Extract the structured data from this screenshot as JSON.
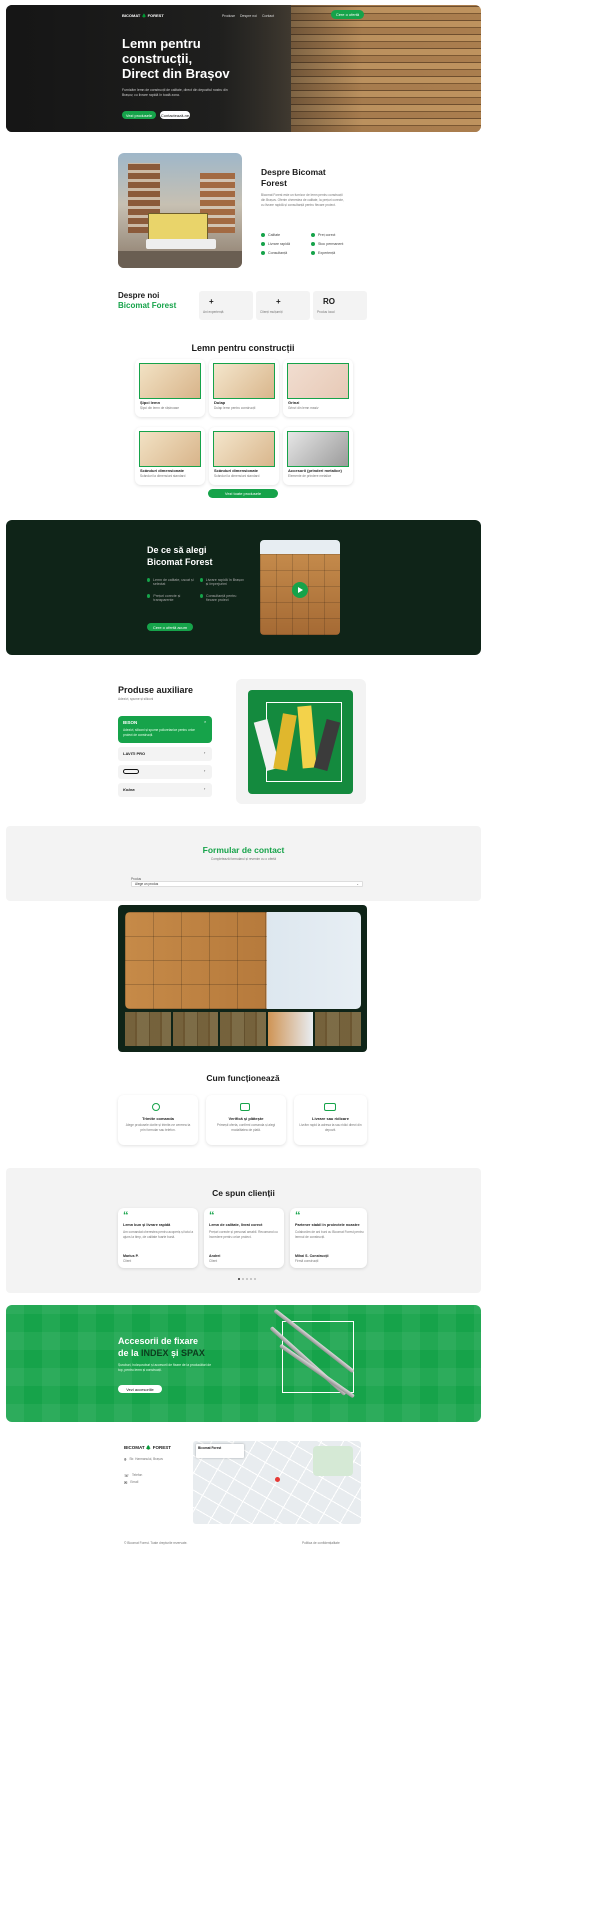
{
  "colors": {
    "accent": "#16a34a",
    "dark_green": "#0f2418",
    "grey": "#f3f3f3"
  },
  "nav": {
    "logo_text": "BICOMAT 🌲 FOREST",
    "links": [
      "Produse",
      "Despre noi",
      "Contact"
    ],
    "cta": "Cere o ofertă"
  },
  "hero": {
    "title_line1": "Lemn pentru",
    "title_line2": "construcții,",
    "title_line3": "Direct din Brașov",
    "desc": "Furnizăm lemn de construcții de calitate, direct din depozitul nostru din Brașov, cu livrare rapidă în toată zona.",
    "btn_primary": "Vezi produsele",
    "btn_secondary": "Contactează-ne"
  },
  "about": {
    "title": "Despre Bicomat Forest",
    "desc": "Bicomat Forest este un furnizor de lemn pentru construcții din Brașov. Oferim cherestea de calitate, la prețuri corecte, cu livrare rapidă și consultanță pentru fiecare proiect.",
    "features": [
      "Calitate",
      "Preț corect",
      "Livrare rapidă",
      "Stoc permanent",
      "Consultanță",
      "Experiență"
    ]
  },
  "stats": {
    "title_1": "Despre noi",
    "title_2": "Bicomat Forest",
    "items": [
      {
        "value": "+",
        "label": "Ani experiență"
      },
      {
        "value": "+",
        "label": "Clienți mulțumiți"
      },
      {
        "value": "RO",
        "label": "Produs local"
      }
    ]
  },
  "products": {
    "title": "Lemn pentru construcții",
    "items": [
      {
        "name": "Șipci lemn",
        "desc": "Șipci din lemn de rășinoase"
      },
      {
        "name": "Dulap",
        "desc": "Dulap lemn pentru construcții"
      },
      {
        "name": "Grinzi",
        "desc": "Grinzi din lemn masiv"
      },
      {
        "name": "Scânduri dimensionate",
        "desc": "Scânduri la dimensiuni standard"
      },
      {
        "name": "Scânduri dimensionate",
        "desc": "Scânduri la dimensiuni standard"
      },
      {
        "name": "Accesorii (prinderi metalice)",
        "desc": "Elemente de prindere metalice"
      }
    ],
    "cta": "Vezi toate produsele"
  },
  "why": {
    "title_line1": "De ce să alegi",
    "title_line2": "Bicomat Forest",
    "features": [
      "Lemn de calitate, uscat și selectat",
      "Livrare rapidă în Brașov și împrejurimi",
      "Prețuri corecte și transparente",
      "Consultanță pentru fiecare proiect"
    ],
    "cta": "Cere o ofertă acum"
  },
  "aux": {
    "title": "Produse auxiliare",
    "subtitle": "Adezivi, spume și siliconi",
    "brands": [
      "BISON",
      "LAVITI PRO",
      "",
      "Kobra"
    ],
    "active_desc": "Adezivi, siliconi și spume poliuretanice pentru orice proiect de construcții."
  },
  "contact": {
    "title": "Formular de contact",
    "subtitle": "Completează formularul și revenim cu o ofertă",
    "select_label": "Produs",
    "select_value": "Alege un produs"
  },
  "how": {
    "title": "Cum funcționează",
    "steps": [
      {
        "title": "Trimite comanda",
        "desc": "Alege produsele dorite și trimite-ne cererea ta prin formular sau telefon."
      },
      {
        "title": "Verifică și plătește",
        "desc": "Primești oferta, confirmi comanda și alegi modalitatea de plată."
      },
      {
        "title": "Livrare sau ridicare",
        "desc": "Livrăm rapid la adresa ta sau ridici direct din depozit."
      }
    ]
  },
  "testimonials": {
    "title": "Ce spun clienții",
    "items": [
      {
        "title": "Lemn bun și livrare rapidă",
        "text": "Am comandat cherestea pentru acoperiș și totul a ajuns la timp, de calitate foarte bună.",
        "author": "Marius P.",
        "role": "Client"
      },
      {
        "title": "Lemn de calitate, livrat corect",
        "text": "Prețuri corecte și personal amabil. Recomand cu încredere pentru orice proiect.",
        "author": "Andrei",
        "role": "Client"
      },
      {
        "title": "Partener stabil în proiectele noastre",
        "text": "Colaborăm de ani buni cu Bicomat Forest pentru lemnul de construcții.",
        "author": "Mihai S. Construcții",
        "role": "Firmă construcții"
      }
    ]
  },
  "accessories": {
    "title_line1": "Accesorii de fixare",
    "title_line2_a": "de la ",
    "title_line2_b": "INDEX",
    "title_line2_c": " și ",
    "title_line2_d": "SPAX",
    "desc": "Șuruburi, holzșuruburi și accesorii de fixare de la producători de top, pentru lemn și construcții.",
    "cta": "Vezi accesoriile"
  },
  "footer": {
    "logo_text": "BICOMAT 🌲 FOREST",
    "address": "Str. Harmanului, Brașov",
    "phone": "Telefon",
    "email": "Email",
    "map_title": "Bicomat Forest",
    "bottom_left": "© Bicomat Forest. Toate drepturile rezervate.",
    "bottom_right": "Politica de confidențialitate"
  }
}
